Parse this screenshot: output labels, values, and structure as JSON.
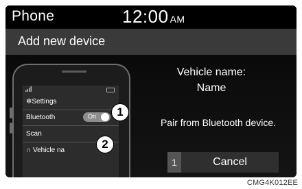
{
  "statusbar": {
    "app": "Phone",
    "time": "12:00",
    "ampm": "AM"
  },
  "title": "Add new device",
  "phone_illustration": {
    "settings_label": "Settings",
    "bluetooth_label": "Bluetooth",
    "toggle_label": "On",
    "scan_label": "Scan",
    "device_item": "Vehicle na"
  },
  "callouts": [
    "1",
    "2"
  ],
  "vehicle_name_label": "Vehicle name:",
  "vehicle_name_value": "Name",
  "pair_message": "Pair from Bluetooth device.",
  "cancel_button": {
    "number": "1",
    "label": "Cancel"
  },
  "caption": "CMG4K012EE"
}
